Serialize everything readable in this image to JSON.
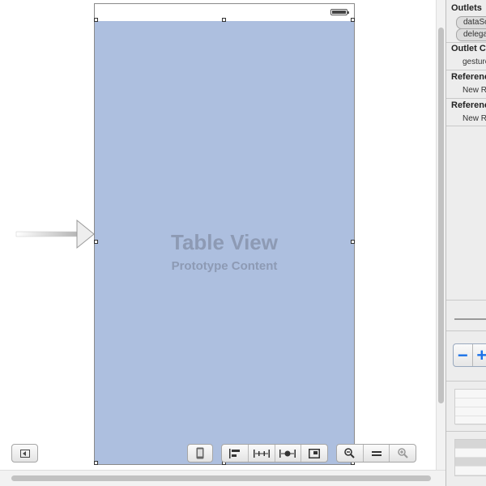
{
  "canvas": {
    "table_view": {
      "title": "Table View",
      "subtitle": "Prototype Content",
      "background": "#adbfdf",
      "label_color": "#8d9ab4"
    },
    "toolbar": {
      "sidebar_toggle": "toggle-document-outline",
      "device_button": "device-form-icon",
      "layout_buttons": [
        "align-icon",
        "pin-icon",
        "resolve-autolayout-icon",
        "resizing-icon"
      ],
      "zoom_buttons": [
        "zoom-out-icon",
        "zoom-actual-icon",
        "zoom-in-icon"
      ]
    }
  },
  "inspector": {
    "outlets_header": "Outlets",
    "outlets": [
      "dataSo",
      "delega"
    ],
    "outlet_collections_header": "Outlet C",
    "outlet_collections": [
      "gesture"
    ],
    "referencing_header_1": "Referenc",
    "referencing_item_1": "New Re",
    "referencing_header_2": "Referenc",
    "referencing_item_2": "New Re",
    "accent": "#1b72e8"
  }
}
